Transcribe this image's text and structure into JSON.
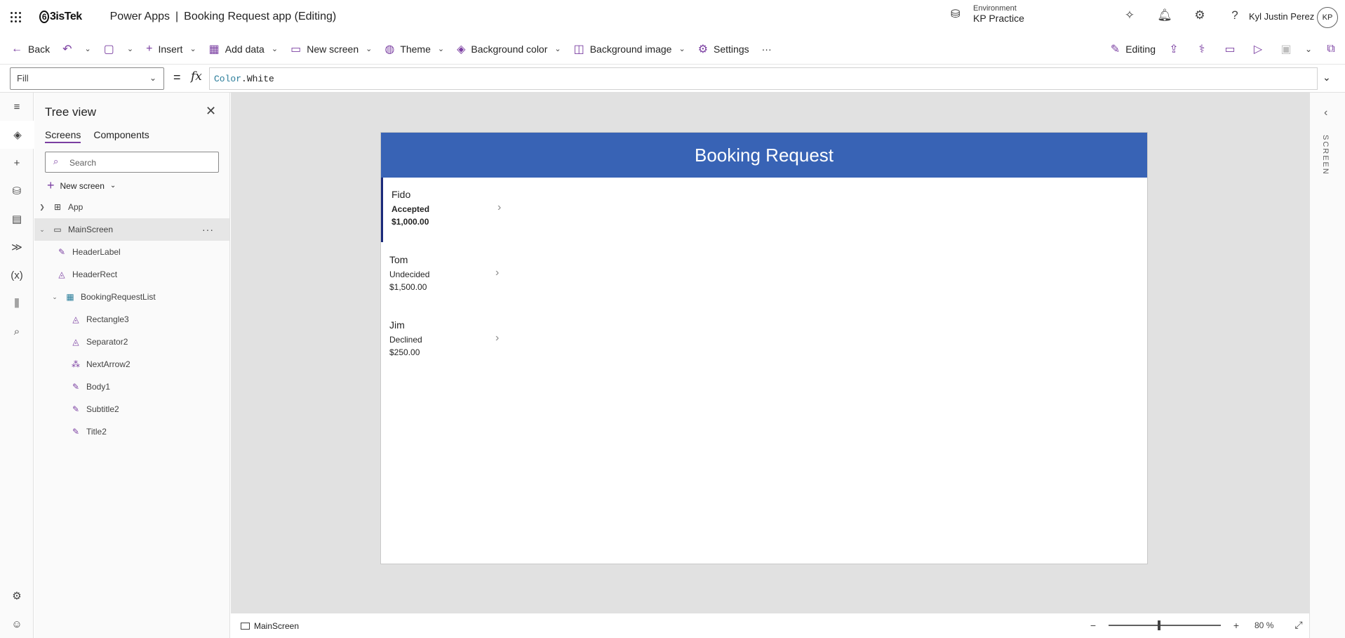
{
  "topbar": {
    "logo": "3isTek",
    "product": "Power Apps",
    "app_title": "Booking Request app (Editing)",
    "env_label": "Environment",
    "env_value": "KP Practice",
    "user_name": "Kyl Justin Perez",
    "avatar_initials": "KP"
  },
  "cmdbar": {
    "back": "Back",
    "insert": "Insert",
    "add_data": "Add data",
    "new_screen": "New screen",
    "theme": "Theme",
    "background_color": "Background color",
    "background_image": "Background image",
    "settings": "Settings",
    "more": "···",
    "editing": "Editing"
  },
  "formula": {
    "property": "Fill",
    "value_object": "Color",
    "value_member": ".White"
  },
  "tree": {
    "title": "Tree view",
    "tabs": [
      "Screens",
      "Components"
    ],
    "search_placeholder": "Search",
    "new_screen": "New screen",
    "nodes": {
      "app": "App",
      "main_screen": "MainScreen",
      "header_label": "HeaderLabel",
      "header_rect": "HeaderRect",
      "booking_list": "BookingRequestList",
      "rectangle3": "Rectangle3",
      "separator2": "Separator2",
      "next_arrow2": "NextArrow2",
      "body1": "Body1",
      "subtitle2": "Subtitle2",
      "title2": "Title2"
    }
  },
  "app_screen": {
    "header": "Booking Request",
    "items": [
      {
        "title": "Fido",
        "subtitle": "Accepted",
        "body": "$1,000.00"
      },
      {
        "title": "Tom",
        "subtitle": "Undecided",
        "body": "$1,500.00"
      },
      {
        "title": "Jim",
        "subtitle": "Declined",
        "body": "$250.00"
      }
    ]
  },
  "right_panel": {
    "label": "SCREEN"
  },
  "statusbar": {
    "screen_name": "MainScreen",
    "zoom_value": "80",
    "zoom_unit": "%",
    "zoom_fraction": 0.44
  },
  "colors": {
    "accent": "#7a3ea1",
    "header_blue": "#3863b5",
    "selected_border": "#1a2a7a"
  }
}
